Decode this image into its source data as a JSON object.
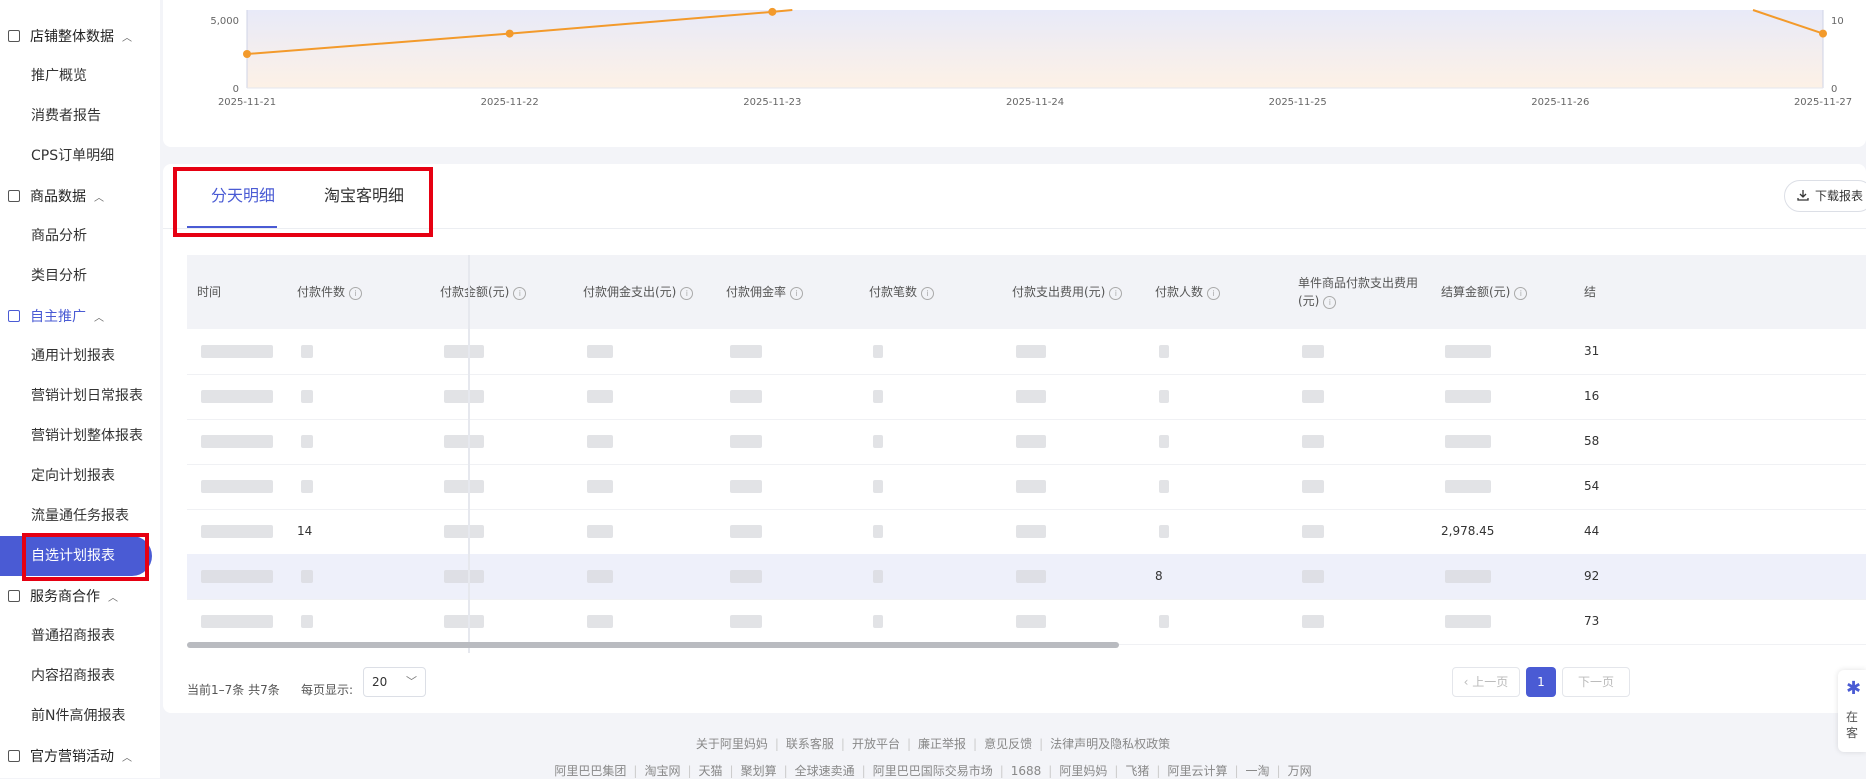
{
  "sidebar": {
    "groups": [
      {
        "label": "店铺整体数据",
        "caret": "︿"
      },
      {
        "label": "商品数据",
        "caret": "︿"
      },
      {
        "label": "自主推广",
        "caret": "︿"
      },
      {
        "label": "服务商合作",
        "caret": "︿"
      },
      {
        "label": "官方营销活动",
        "caret": "︿"
      }
    ],
    "items": [
      "推广概览",
      "消费者报告",
      "CPS订单明细",
      "商品分析",
      "类目分析",
      "通用计划报表",
      "营销计划日常报表",
      "营销计划整体报表",
      "定向计划报表",
      "流量通任务报表",
      "自选计划报表",
      "普通招商报表",
      "内容招商报表",
      "前N件高佣报表"
    ]
  },
  "chart_data": {
    "type": "line",
    "x": [
      "2025-11-21",
      "2025-11-22",
      "2025-11-23",
      "2025-11-24",
      "2025-11-25",
      "2025-11-26",
      "2025-11-27"
    ],
    "series": [
      {
        "values": [
          2500,
          4000,
          5600,
          null,
          null,
          null,
          4000
        ]
      }
    ],
    "y_left_ticks": [
      "0",
      "5,000"
    ],
    "y_right_ticks": [
      "0",
      "10"
    ],
    "colors": {
      "line": "#f39a2b",
      "area_top": "#e8eaf8",
      "area_bottom": "#fdf1e6"
    }
  },
  "tabs": [
    {
      "label": "分天明细",
      "active": true
    },
    {
      "label": "淘宝客明细",
      "active": false
    }
  ],
  "download": {
    "label": "下载报表",
    "icon": "download-icon"
  },
  "table": {
    "headers": [
      "时间",
      "付款件数",
      "付款金额(元)",
      "付款佣金支出(元)",
      "付款佣金率",
      "付款笔数",
      "付款支出费用(元)",
      "付款人数",
      "单件商品付款支出费用\n(元)",
      "结算金额(元)",
      "结"
    ],
    "header_has_info": [
      false,
      true,
      true,
      true,
      true,
      true,
      true,
      true,
      true,
      true,
      false
    ],
    "rows": [
      {
        "partial": [
          "",
          "",
          "",
          "",
          "",
          "",
          "",
          "",
          "",
          "",
          "31"
        ]
      },
      {
        "partial": [
          "",
          "",
          "",
          "",
          "",
          "",
          "",
          "",
          "",
          "",
          "16"
        ]
      },
      {
        "partial": [
          "",
          "",
          "",
          "",
          "",
          "",
          "",
          "",
          "",
          "",
          "58"
        ]
      },
      {
        "partial": [
          "",
          "",
          "",
          "",
          "",
          "",
          "",
          "",
          "",
          "",
          "54"
        ]
      },
      {
        "partial": [
          "",
          "14",
          "",
          "",
          "",
          "",
          "",
          "",
          "",
          "2,978.45",
          "44"
        ]
      },
      {
        "partial": [
          "",
          "",
          "",
          "",
          "",
          "",
          "",
          "8",
          "",
          "",
          "92"
        ]
      },
      {
        "partial": [
          "",
          "",
          "",
          "",
          "",
          "",
          "",
          "",
          "",
          "",
          "73"
        ]
      }
    ]
  },
  "pagination": {
    "summary": "当前1–7条 共7条",
    "page_size_label": "每页显示:",
    "page_size": "20",
    "prev": "上一页",
    "current": "1",
    "next": "下一页"
  },
  "float_widget": {
    "lines": [
      "在",
      "客"
    ]
  },
  "footer": {
    "row1": [
      "关于阿里妈妈",
      "联系客服",
      "开放平台",
      "廉正举报",
      "意见反馈",
      "法律声明及隐私权政策"
    ],
    "row2": [
      "阿里巴巴集团",
      "淘宝网",
      "天猫",
      "聚划算",
      "全球速卖通",
      "阿里巴巴国际交易市场",
      "1688",
      "阿里妈妈",
      "飞猪",
      "阿里云计算",
      "一淘",
      "万网"
    ]
  }
}
